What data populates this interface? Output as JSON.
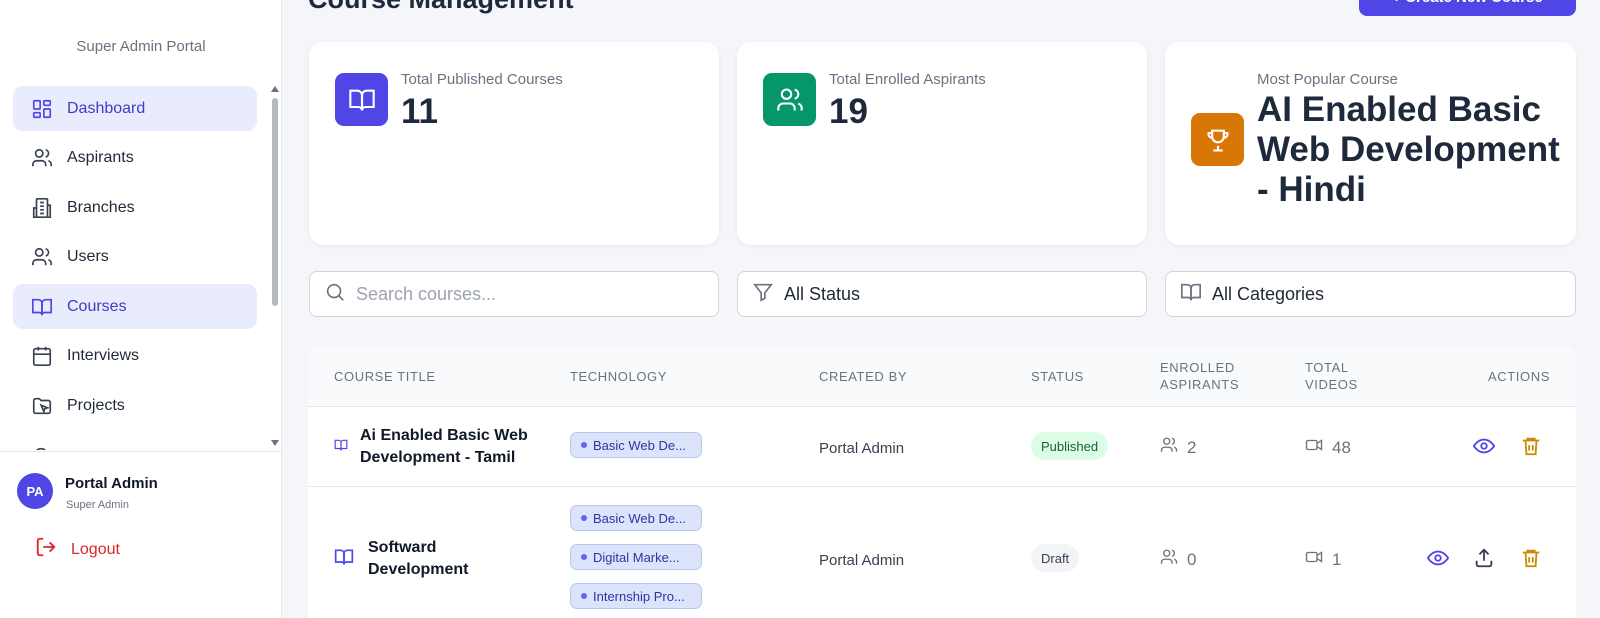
{
  "sidebar": {
    "portal_title": "Super Admin Portal",
    "items": [
      {
        "label": "Dashboard",
        "icon": "dashboard-icon",
        "active": true
      },
      {
        "label": "Aspirants",
        "icon": "users-icon",
        "active": false
      },
      {
        "label": "Branches",
        "icon": "building-icon",
        "active": false
      },
      {
        "label": "Users",
        "icon": "users-icon",
        "active": false
      },
      {
        "label": "Courses",
        "icon": "book-open-icon",
        "active": true
      },
      {
        "label": "Interviews",
        "icon": "calendar-icon",
        "active": false
      },
      {
        "label": "Projects",
        "icon": "folder-icon",
        "active": false
      }
    ],
    "user": {
      "initials": "PA",
      "name": "Portal Admin",
      "role": "Super Admin"
    },
    "logout_label": "Logout"
  },
  "header": {
    "title": "Course Management",
    "create_button": "+ Create New Course"
  },
  "stats": {
    "published": {
      "label": "Total Published Courses",
      "value": "11"
    },
    "enrolled": {
      "label": "Total Enrolled Aspirants",
      "value": "19"
    },
    "popular": {
      "label": "Most Popular Course",
      "value": "AI Enabled Basic Web Development - Hindi"
    }
  },
  "filters": {
    "search_placeholder": "Search courses...",
    "status": "All Status",
    "category": "All Categories"
  },
  "table": {
    "columns": {
      "title": "COURSE TITLE",
      "technology": "TECHNOLOGY",
      "created_by": "CREATED BY",
      "status": "STATUS",
      "enrolled": "ENROLLED ASPIRANTS",
      "videos": "TOTAL VIDEOS",
      "actions": "ACTIONS"
    },
    "rows": [
      {
        "title": "Ai Enabled Basic Web Development - Tamil",
        "tags": [
          "Basic Web De..."
        ],
        "created_by": "Portal Admin",
        "status": "Published",
        "enrolled": "2",
        "videos": "48"
      },
      {
        "title": "Softward Development",
        "tags": [
          "Basic Web De...",
          "Digital Marke...",
          "Internship Pro..."
        ],
        "created_by": "Portal Admin",
        "status": "Draft",
        "enrolled": "0",
        "videos": "1"
      }
    ]
  },
  "colors": {
    "accent": "#4f46e5",
    "enrolled_icon_bg": "#059669",
    "popular_icon_bg": "#d97706",
    "danger": "#dc2626",
    "delete_icon": "#ca8a04"
  }
}
